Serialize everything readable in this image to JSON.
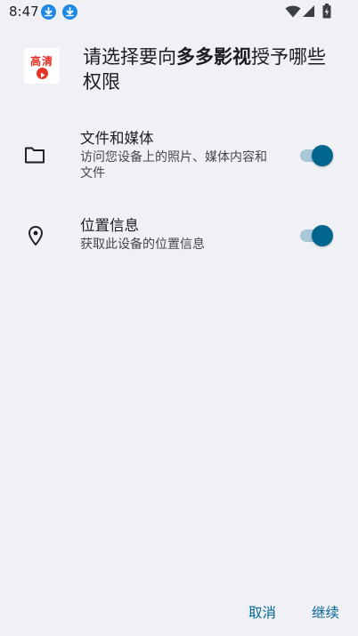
{
  "status_bar": {
    "time": "8:47",
    "notification_icons": [
      "download-icon",
      "download-icon"
    ],
    "system_icons": [
      "wifi-icon",
      "cellular-signal-icon",
      "battery-charging-icon"
    ]
  },
  "dialog": {
    "app_icon": {
      "name": "app-logo",
      "text": "高清",
      "accent_color": "#e5332a"
    },
    "title_prefix": "请选择要向",
    "title_app_name": "多多影视",
    "title_suffix": "授予哪些权限",
    "permissions": [
      {
        "icon": "folder-icon",
        "title": "文件和媒体",
        "description": "访问您设备上的照片、媒体内容和文件",
        "enabled": true
      },
      {
        "icon": "location-pin-icon",
        "title": "位置信息",
        "description": "获取此设备的位置信息",
        "enabled": true
      }
    ],
    "buttons": {
      "cancel": "取消",
      "continue": "继续"
    }
  },
  "colors": {
    "background": "#f0f1f4",
    "accent": "#00658f",
    "toggle_track": "#a8c7d9",
    "button_text": "#006495"
  }
}
